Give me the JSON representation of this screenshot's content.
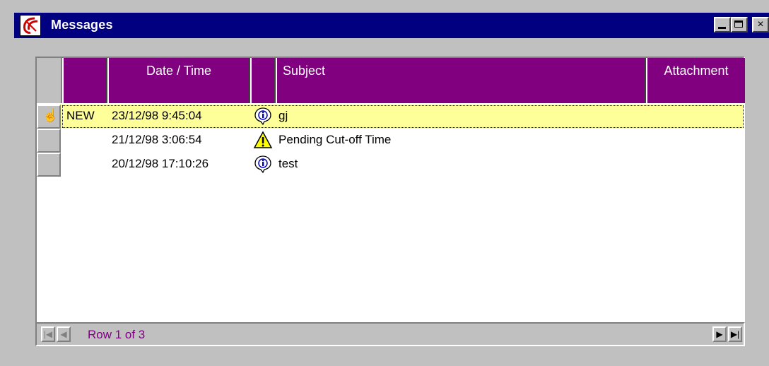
{
  "window": {
    "title": "Messages"
  },
  "title_buttons": {
    "minimize": "",
    "maximize": "",
    "close": "×"
  },
  "columns": {
    "date_time": "Date / Time",
    "subject": "Subject",
    "attachment": "Attachment"
  },
  "rows": [
    {
      "flag": "NEW",
      "date_time": "23/12/98 9:45:04",
      "icon": "info-icon",
      "subject": "gj",
      "selected": true
    },
    {
      "flag": "",
      "date_time": "21/12/98 3:06:54",
      "icon": "warning-icon",
      "subject": "Pending Cut-off Time",
      "selected": false
    },
    {
      "flag": "",
      "date_time": "20/12/98 17:10:26",
      "icon": "info-icon",
      "subject": "test",
      "selected": false
    }
  ],
  "navigator": {
    "status": "Row 1 of 3",
    "first": "|◀",
    "prev": "◀",
    "next": "▶",
    "last": "▶|"
  },
  "colors": {
    "title_bar": "#000080",
    "header": "#800080",
    "selected_row": "#ffff99"
  }
}
